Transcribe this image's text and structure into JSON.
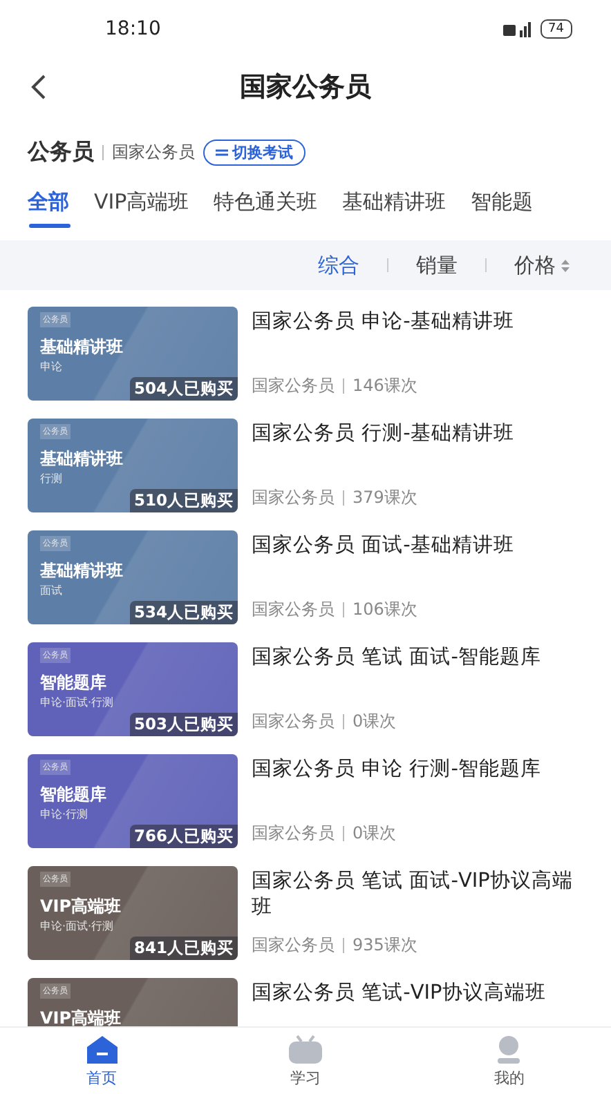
{
  "status_bar": {
    "time": "18:10",
    "battery": "74"
  },
  "header": {
    "title": "国家公务员"
  },
  "exam": {
    "category": "公务员",
    "name": "国家公务员",
    "switch_label": "切换考试"
  },
  "tabs": [
    {
      "label": "全部",
      "selected": true
    },
    {
      "label": "VIP高端班",
      "selected": false
    },
    {
      "label": "特色通关班",
      "selected": false
    },
    {
      "label": "基础精讲班",
      "selected": false
    },
    {
      "label": "智能题",
      "selected": false
    }
  ],
  "sort_options": [
    {
      "label": "综合",
      "selected": true,
      "kind": "plain"
    },
    {
      "label": "销量",
      "selected": false,
      "kind": "plain"
    },
    {
      "label": "价格",
      "selected": false,
      "kind": "sortable"
    }
  ],
  "courses": [
    {
      "thumb_tag": "公务员",
      "thumb_title": "基础精讲班",
      "thumb_subtitle": "申论",
      "buyers": "504人已购买",
      "color": "#5d7ea6",
      "title": "国家公务员 申论-基础精讲班",
      "exam": "国家公务员",
      "lessons": "146课次"
    },
    {
      "thumb_tag": "公务员",
      "thumb_title": "基础精讲班",
      "thumb_subtitle": "行测",
      "buyers": "510人已购买",
      "color": "#5d7ea6",
      "title": "国家公务员 行测-基础精讲班",
      "exam": "国家公务员",
      "lessons": "379课次"
    },
    {
      "thumb_tag": "公务员",
      "thumb_title": "基础精讲班",
      "thumb_subtitle": "面试",
      "buyers": "534人已购买",
      "color": "#5d7ea6",
      "title": "国家公务员 面试-基础精讲班",
      "exam": "国家公务员",
      "lessons": "106课次"
    },
    {
      "thumb_tag": "公务员",
      "thumb_title": "智能题库",
      "thumb_subtitle": "申论·面试·行测",
      "buyers": "503人已购买",
      "color": "#5f62b8",
      "title": "国家公务员 笔试 面试-智能题库",
      "exam": "国家公务员",
      "lessons": "0课次"
    },
    {
      "thumb_tag": "公务员",
      "thumb_title": "智能题库",
      "thumb_subtitle": "申论·行测",
      "buyers": "766人已购买",
      "color": "#5f62b8",
      "title": "国家公务员 申论 行测-智能题库",
      "exam": "国家公务员",
      "lessons": "0课次"
    },
    {
      "thumb_tag": "公务员",
      "thumb_title": "VIP高端班",
      "thumb_subtitle": "申论·面试·行测",
      "buyers": "841人已购买",
      "color": "#6a5f5a",
      "title": "国家公务员 笔试 面试-VIP协议高端班",
      "exam": "国家公务员",
      "lessons": "935课次"
    },
    {
      "thumb_tag": "公务员",
      "thumb_title": "VIP高端班",
      "color": "#6a5f5a",
      "title": "国家公务员 笔试-VIP协议高端班"
    }
  ],
  "bottom_nav": [
    {
      "label": "首页",
      "selected": true,
      "kind": "home"
    },
    {
      "label": "学习",
      "selected": false,
      "kind": "study"
    },
    {
      "label": "我的",
      "selected": false,
      "kind": "profile"
    }
  ]
}
